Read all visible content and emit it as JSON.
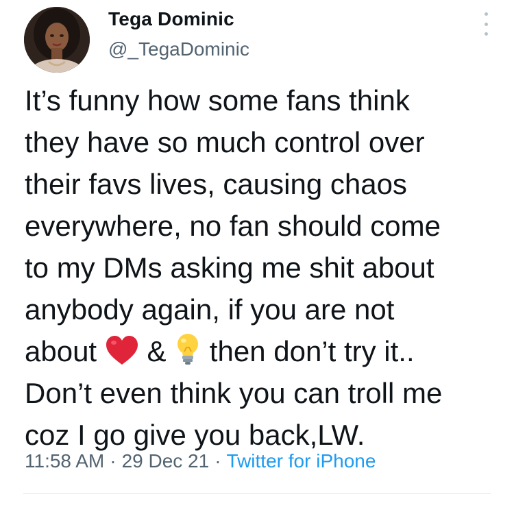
{
  "tweet": {
    "author": {
      "display_name": "Tega Dominic",
      "handle": "@_TegaDominic",
      "avatar_icon": "profile-photo"
    },
    "more_icon": "more-vertical-icon",
    "body_lines": [
      "It’s funny how some fans think",
      "they have so much control over",
      "their favs lives, causing chaos",
      "everywhere, no fan should come",
      "to my DMs asking me shit about",
      "anybody again, if you are not"
    ],
    "line7": {
      "before": "about ",
      "heart_icon": "red-heart-emoji",
      "mid": " & ",
      "bulb_icon": "light-bulb-emoji",
      "after": " then don’t try it.."
    },
    "body_lines_end": [
      "Don’t even think you can troll me",
      "coz I go give you back,LW."
    ],
    "meta": {
      "time": "11:58 AM",
      "separator": "·",
      "date": "29 Dec 21",
      "source": "Twitter for iPhone"
    },
    "colors": {
      "text": "#0f1419",
      "secondary": "#536471",
      "link": "#1d9bf0",
      "heart": "#e0243a",
      "bulb": "#ffd23f"
    }
  }
}
